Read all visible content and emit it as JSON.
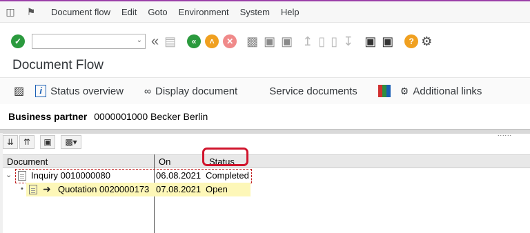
{
  "menu": {
    "items": [
      "Document flow",
      "Edit",
      "Goto",
      "Environment",
      "System",
      "Help"
    ]
  },
  "screen": {
    "title": "Document Flow"
  },
  "app_toolbar": {
    "status_overview": "Status overview",
    "display_document": "Display document",
    "service_documents": "Service documents",
    "additional_links": "Additional links"
  },
  "business_partner": {
    "label": "Business partner",
    "value": "0000001000 Becker Berlin"
  },
  "table": {
    "headers": {
      "document": "Document",
      "on": "On",
      "status": "Status"
    },
    "rows": [
      {
        "document": "Inquiry 0010000080",
        "on": "06.08.2021",
        "status": "Completed"
      },
      {
        "document": "Quotation 0020000173",
        "on": "07.08.2021",
        "status": "Open"
      }
    ]
  },
  "colors": {
    "accent": "#9b3fa8",
    "highlight_box": "#d0142c",
    "current_row": "#fdf7b8"
  },
  "icons": [
    "menu-icon",
    "sap-icon",
    "enter-check-icon",
    "back-icon",
    "save-icon",
    "nav-back-icon",
    "exit-icon",
    "cancel-icon",
    "print-icon",
    "find-icon",
    "find-next-icon",
    "first-page-icon",
    "prev-page-icon",
    "next-page-icon",
    "last-page-icon",
    "new-session-icon",
    "shortcut-icon",
    "help-icon",
    "settings-icon"
  ]
}
